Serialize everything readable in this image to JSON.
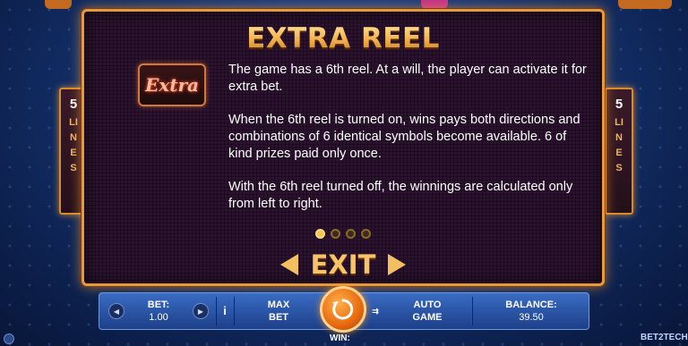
{
  "screen": {
    "title": "EXTRA REEL",
    "logo_text": "Extra",
    "paragraphs": [
      "The game has a 6th reel. At a will, the player can activate it for extra bet.",
      "When the 6th reel is turned on, wins pays both directions and combinations of 6 identical symbols become available. 6 of kind prizes paid only once.",
      "With the 6th reel turned off, the winnings are calculated only from left to right."
    ],
    "pager": {
      "total": 4,
      "active_index": 0
    },
    "exit_label": "EXIT"
  },
  "side_badges": {
    "number": "5",
    "word": "LINES"
  },
  "bottom_bar": {
    "bet_label": "BET:",
    "bet_value": "1.00",
    "info_label": "i",
    "max_bet_line1": "MAX",
    "max_bet_line2": "BET",
    "auto_game_line1": "AUTO",
    "auto_game_line2": "GAME",
    "balance_label": "BALANCE:",
    "balance_value": "39.50",
    "win_label": "WIN:"
  },
  "brand": "BET2TECH",
  "colors": {
    "accent_gold": "#f2b04a",
    "panel_bg": "#2c1230",
    "bar_blue": "#2a55a8",
    "spin_orange": "#e86a10"
  },
  "icons": [
    "left-arrow-icon",
    "right-arrow-icon",
    "info-icon",
    "spin-icon",
    "autoplay-icon",
    "sound-icon"
  ]
}
